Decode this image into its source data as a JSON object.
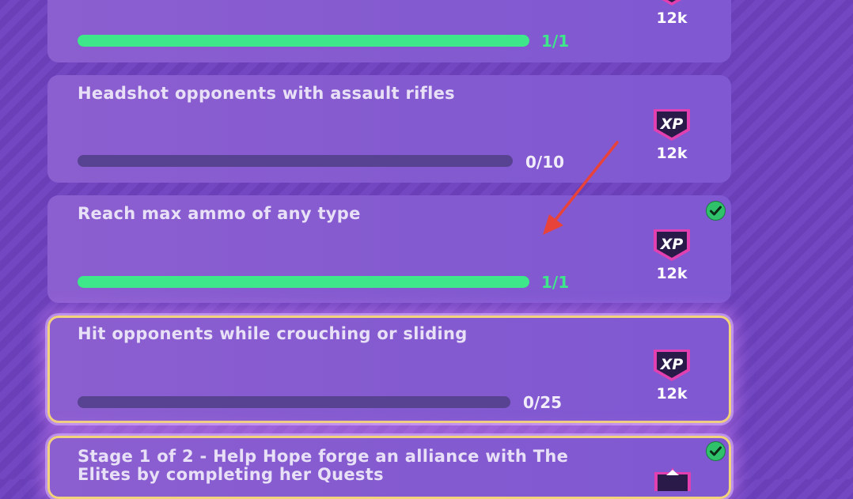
{
  "quests": [
    {
      "title": "",
      "progress_label": "1/1",
      "progress": 1.0,
      "complete": true,
      "xp_label": "XP",
      "reward": "12k",
      "selected": false,
      "checked": false
    },
    {
      "title": "Headshot opponents with assault rifles",
      "progress_label": "0/10",
      "progress": 0.0,
      "complete": false,
      "xp_label": "XP",
      "reward": "12k",
      "selected": false,
      "checked": false
    },
    {
      "title": "Reach max ammo of any type",
      "progress_label": "1/1",
      "progress": 1.0,
      "complete": true,
      "xp_label": "XP",
      "reward": "12k",
      "selected": false,
      "checked": true
    },
    {
      "title": "Hit opponents while crouching or sliding",
      "progress_label": "0/25",
      "progress": 0.0,
      "complete": false,
      "xp_label": "XP",
      "reward": "12k",
      "selected": true,
      "checked": false
    },
    {
      "title": "Stage 1 of 2 - Help Hope forge an alliance with The Elites by completing her Quests",
      "selected": true,
      "checked": true
    }
  ],
  "colors": {
    "progress_fill": "#3ee88a",
    "progress_track": "#574391",
    "selection_border": "#f2d27a",
    "annotation_arrow": "#e8433a"
  }
}
